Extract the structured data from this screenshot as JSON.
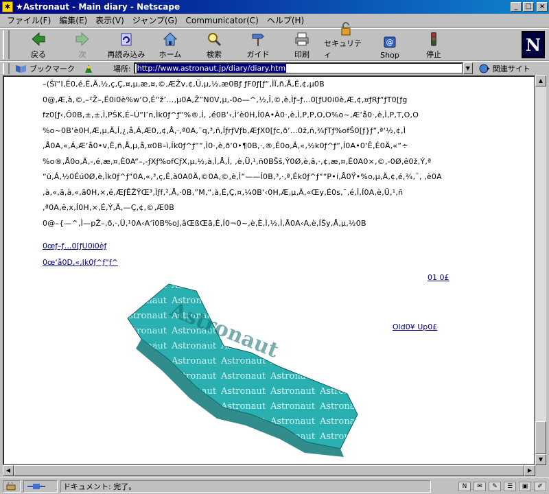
{
  "window": {
    "title": "★Astronaut - Main diary - Netscape",
    "buttons": [
      "_",
      "□",
      "×"
    ]
  },
  "menu": [
    "ファイル(F)",
    "編集(E)",
    "表示(V)",
    "ジャンプ(G)",
    "Communicator(C)",
    "ヘルプ(H)"
  ],
  "toolbar": {
    "back": "戻る",
    "forward": "次",
    "reload": "再読み込み",
    "home": "ホーム",
    "search": "検索",
    "guide": "ガイド",
    "print": "印刷",
    "security": "セキュリティ",
    "shop": "Shop",
    "stop": "停止",
    "logo": "N"
  },
  "location": {
    "bookmarks": "ブックマーク",
    "label": "場所:",
    "url": "http://www.astronaut.jp/diary/diary.htm",
    "related": "関連サイト"
  },
  "content": {
    "lines": [
      "–(Šï“I‚Ë0‚é‚Ë‚Ä‚½‚ç‚Ç‚¤‚µ‚æ‚¤‚©‚ÆŽv‚¢‚Ü‚µ‚½‚æ0Bƒ ƒF0ƒ[ƒ“‚ÌÏ‚ñ‚Å‚Ë‚¢‚µ0B",
      "0@‚Æ‚à‚©‚–²Ž–‚Ë0i0è%w‘O‚É“ž’…‚µ0A‚Ž”N0V‚µ‚-0o—^‚½‚Î‚©‚è‚Ìƒ–ƒ…0[ƒU0i0è‚Æ‚¢‚¤ƒRƒ“ƒT0[ƒg",
      "fz0[ƒ‹‚Ö0B‚±‚±‚Ì‚PŠK‚É–Ú“I’n‚Ìk0ƒ^ƒ“%®‚Í‚ ‚é0B‘‹‚Ì‘è0H‚Í0A•À0·‚è‚Ì‚P‚P‚O‚O%o~‚Æ‘å0·‚è‚Ì‚P‚T‚O‚O",
      "%o~0B‘è0H‚Æ‚µ‚Ä‚Í‚¿‚å‚Á‚Æ0‚‚¢‚Å‚·‚ª0A‚¨q‚³‚ñ‚ÍƒrƒVƒb‚ÆƒX0[ƒc‚ð’…0ž‚ñ‚¾ƒTƒ%ofŠ0[ƒ}ƒ“‚ª‘½‚¢‚Ì",
      "‚Å0A‚«‚Á‚Æ‘å0•v‚Ë‚ñ‚Å‚µ‚å‚¤0B–ì‚Ík0ƒ^ƒ““‚Ì0·‚è‚ð‘0•¶0B‚·‚®‚É0o‚Ä‚«‚½k0ƒ^ƒ“‚Í0A•0‘Ê‚É0Ä‚«“÷",
      "%o®‚Å0o‚Ä‚-‚é‚æ‚¤‚È0A“–‚-ƒXƒ%ofCƒX‚µ‚½‚à‚Ì‚Å‚Í‚ ‚è‚Ü‚¹‚ñ0BŠš‚Ý0Ø‚è‚â‚·‚¢‚æ‚¤‚É0A0×‚©‚-0Ø‚ê0ž‚Ý‚ª",
      "“ü‚Á‚½0Éú0Ø‚è‚Ìk0ƒ^ƒ“0A‚«‚³‚ç‚É‚à0A0Ä‚©0A‚©‚è‚Ì“——Í0B‚³‚·‚ª‚Ék0ƒ^ƒ““P•i‚Å0Ÿ•%o‚µ‚Ä‚¢‚é‚¾‚¯‚ ‚è0A",
      "‚à‚«‚ã‚à‚«‚ã0H‚×‚é‚ÆƒÊŽŸŒ³‚Ìƒf‚²‚Å‚·0B‚”M‚“‚à‚É‚Ç‚¤‚¼0B‘‹0H‚Æ‚µ‚Ä‚«Œy‚É0s‚¯‚é‚Ì‚Í0A‚è‚Ü‚¹‚ñ",
      "‚ª0A‚ê‚x‚Í0H‚×‚É‚Ý‚Ä‚—Ç‚¢‚©‚Æ0B",
      "0@–{—^‚Ì—pŽ–‚ð‚·‚Ü‚¹0A‹A‘î0B%oJ‚âŒßŒã‚É‚Í0¬0~‚è‚È‚Ì‚½‚Ì‚Å0A‹A‚è‚ÍŠy‚Å‚µ‚½0B"
    ],
    "link_prev": "0œƒ–ƒ…0[ƒU0i0èƒ",
    "link_next": "0œ‘å0D‚«‚Ik0ƒ^ƒ“ƒ^",
    "link_date": "01 0£",
    "link_old_up": "Old0¥ Up0£",
    "art_word": "Astronaut"
  },
  "status": {
    "text": "ドキュメント: 完了。"
  }
}
